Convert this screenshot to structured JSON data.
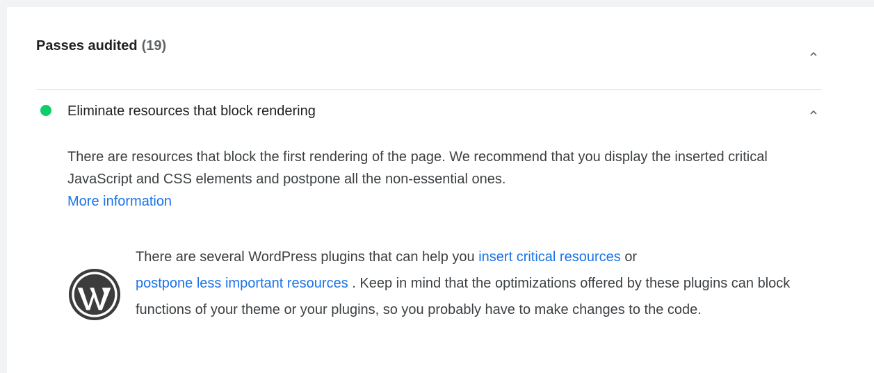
{
  "section": {
    "title": "Passes audited",
    "count": "(19)",
    "chevron_icon": "chevron-up-icon"
  },
  "audit": {
    "status": "pass",
    "status_color": "#0cce6b",
    "title": "Eliminate resources that block rendering",
    "chevron_icon": "chevron-up-icon",
    "description": "There are resources that block the first rendering of the page. We recommend that you display the inserted critical JavaScript and CSS elements and postpone all the non-essential ones.",
    "more_link": "More information"
  },
  "wordpress": {
    "icon": "wordpress-logo-icon",
    "text_before": "There are several WordPress plugins that can help you",
    "link1": "insert critical resources",
    "text_middle": "or",
    "link2": "postpone less important resources",
    "text_after": ". Keep in mind that the optimizations offered by these plugins can block functions of your theme or your plugins, so you probably have to make changes to the code."
  },
  "colors": {
    "link": "#1a73e8",
    "background": "#f1f3f4",
    "card": "#ffffff"
  }
}
